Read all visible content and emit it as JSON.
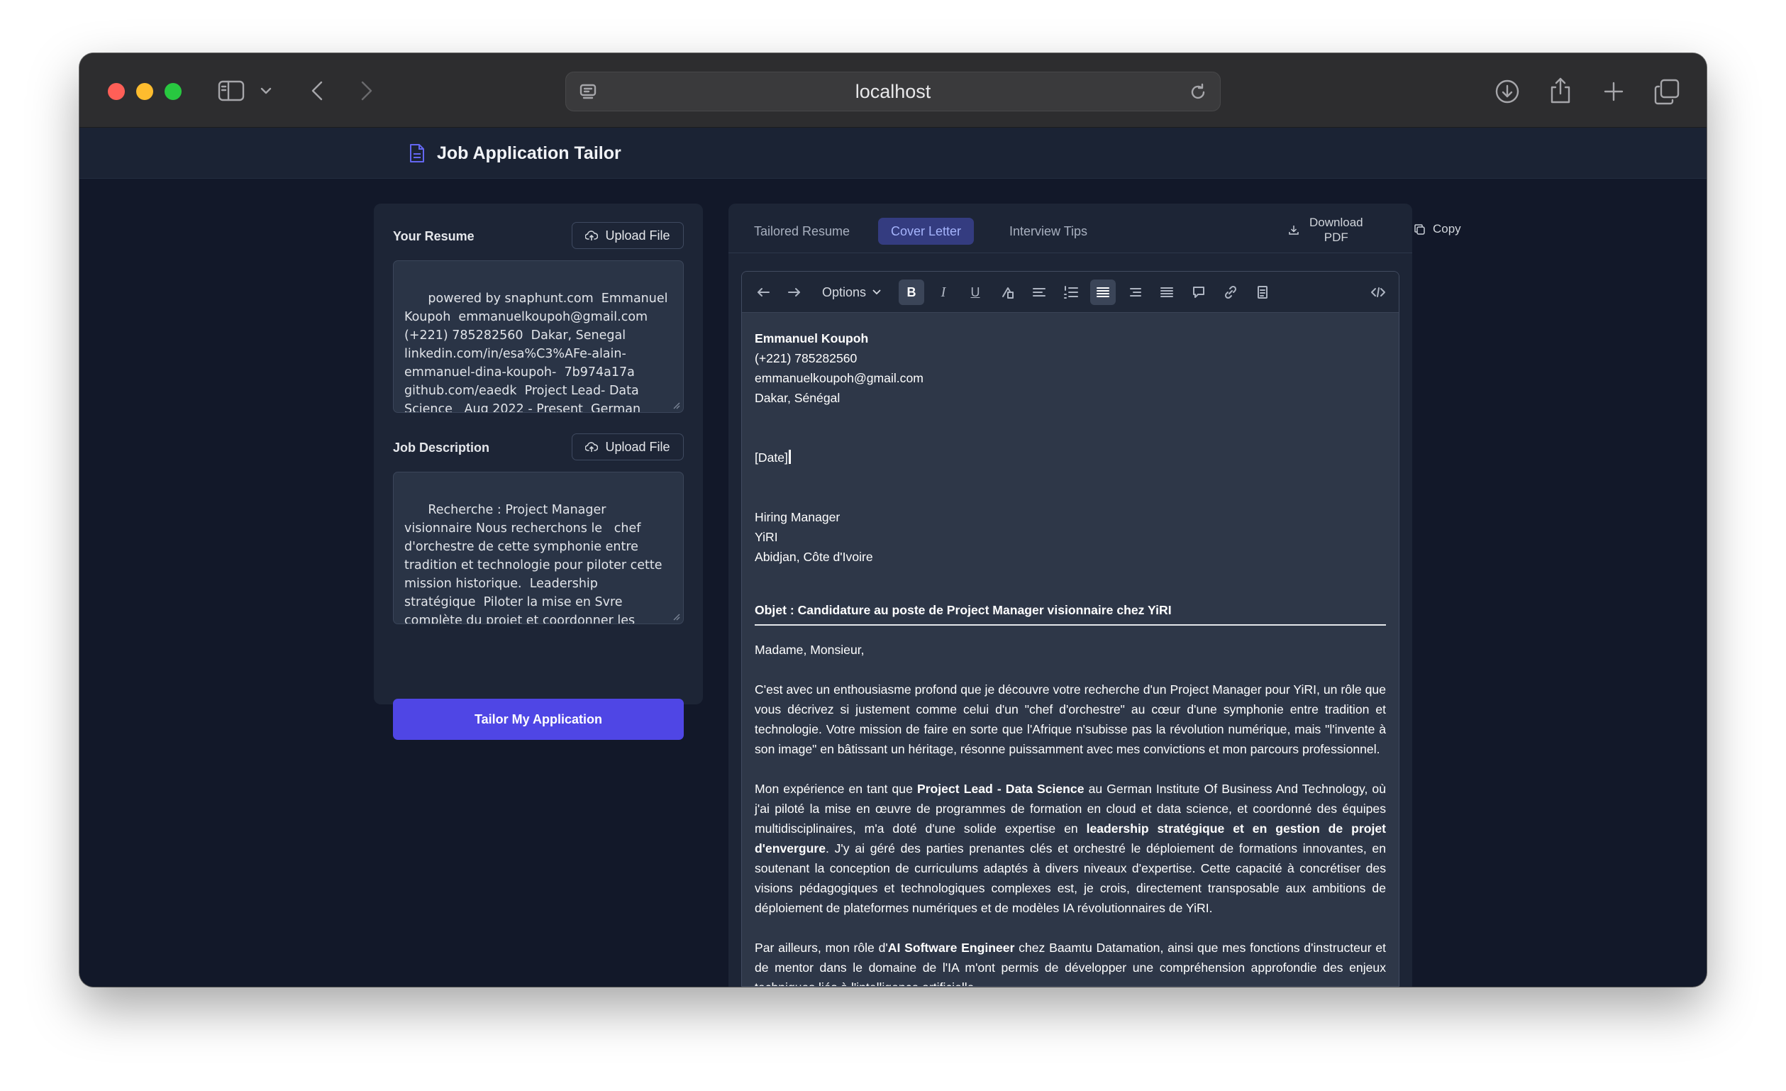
{
  "browser": {
    "url": "localhost"
  },
  "app": {
    "title": "Job Application Tailor"
  },
  "left_panel": {
    "resume": {
      "label": "Your Resume",
      "upload_label": "Upload File",
      "text": "powered by snaphunt.com  Emmanuel Koupoh  emmanuelkoupoh@gmail.com (+221) 785282560  Dakar, Senegal linkedin.com/in/esa%C3%AFe-alain-emmanuel-dina-koupoh-  7b974a17a github.com/eaedk  Project Lead- Data Science   Aug 2022 - Present  German Institute Of Business And Technology  I"
    },
    "job": {
      "label": "Job Description",
      "upload_label": "Upload File",
      "text": "Recherche : Project Manager visionnaire Nous recherchons le   chef d'orchestre de cette symphonie entre tradition et technologie pour piloter cette mission historique.  Leadership stratégique  Piloter la mise en Svre complète du projet et coordonner les équipes multidisciplinaires Gestion budgétaire  Superviser un budget"
    },
    "submit_label": "Tailor My Application"
  },
  "tabs": [
    {
      "label": "Tailored Resume",
      "active": false
    },
    {
      "label": "Cover Letter",
      "active": true
    },
    {
      "label": "Interview Tips",
      "active": false
    }
  ],
  "actions": {
    "download_line1": "Download",
    "download_line2": "PDF",
    "copy_label": "Copy"
  },
  "toolbar": {
    "options_label": "Options",
    "bold": "B",
    "italic": "I",
    "underline": "U"
  },
  "letter": {
    "sender_name": "Emmanuel Koupoh",
    "sender_phone": "(+221) 785282560",
    "sender_email": "emmanuelkoupoh@gmail.com",
    "sender_city": "Dakar, Sénégal",
    "date": "[Date]",
    "recipient_title": "Hiring Manager",
    "recipient_company": "YiRI",
    "recipient_city": "Abidjan, Côte d'Ivoire",
    "subject": "Objet : Candidature au poste de Project Manager visionnaire chez YiRI",
    "greeting": "Madame, Monsieur,",
    "p1": "C'est avec un enthousiasme profond que je découvre votre recherche d'un Project Manager pour YiRI, un rôle que vous décrivez si justement comme celui d'un \"chef d'orchestre\" au cœur d'une symphonie entre tradition et technologie. Votre mission de faire en sorte que l'Afrique n'subisse pas la révolution numérique, mais \"l'invente à son image\" en bâtissant un héritage, résonne puissamment avec mes convictions et mon parcours professionnel.",
    "p2_a": "Mon expérience en tant que ",
    "p2_b": "Project Lead - Data Science",
    "p2_c": " au German Institute Of Business And Technology, où j'ai piloté la mise en œuvre de programmes de formation en cloud et data science, et coordonné des équipes multidisciplinaires, m'a doté d'une solide expertise en ",
    "p2_d": "leadership stratégique et en gestion de projet d'envergure",
    "p2_e": ". J'y ai géré des parties prenantes clés et orchestré le déploiement de formations innovantes, en soutenant la conception de curriculums adaptés à divers niveaux d'expertise. Cette capacité à concrétiser des visions pédagogiques et technologiques complexes est, je crois, directement transposable aux ambitions de déploiement de plateformes numériques et de modèles IA révolutionnaires de YiRI.",
    "p3_a": "Par ailleurs, mon rôle d'",
    "p3_b": "AI Software Engineer",
    "p3_c": " chez Baamtu Datamation, ainsi que mes fonctions d'instructeur et de mentor dans le domaine de l'IA m'ont permis de développer une compréhension approfondie des enjeux techniques liés à l'intelligence artificielle."
  }
}
